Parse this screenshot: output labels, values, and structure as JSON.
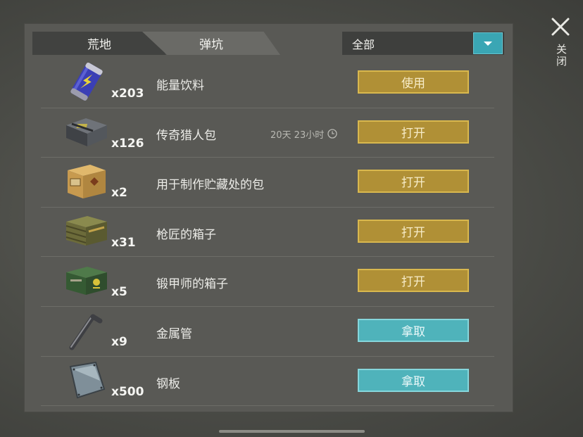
{
  "tabs": [
    {
      "label": "荒地"
    },
    {
      "label": "弹坑"
    }
  ],
  "filter": {
    "label": "全部",
    "dropdown_icon": "chevron-down-icon"
  },
  "close": {
    "label": "关闭",
    "icon": "close-icon"
  },
  "items": [
    {
      "name": "能量饮料",
      "qty": "x203",
      "action": "使用",
      "icon": "energy-drink-can-icon",
      "style": "gold"
    },
    {
      "name": "传奇猎人包",
      "qty": "x126",
      "timer": "20天 23小时",
      "action": "打开",
      "icon": "hunter-bag-icon",
      "style": "gold"
    },
    {
      "name": "用于制作贮藏处的包",
      "qty": "x2",
      "action": "打开",
      "icon": "wooden-crate-icon",
      "style": "gold"
    },
    {
      "name": "枪匠的箱子",
      "qty": "x31",
      "action": "打开",
      "icon": "gunsmith-crate-icon",
      "style": "gold"
    },
    {
      "name": "锻甲师的箱子",
      "qty": "x5",
      "action": "打开",
      "icon": "armorsmith-box-icon",
      "style": "gold"
    },
    {
      "name": "金属管",
      "qty": "x9",
      "action": "拿取",
      "icon": "metal-pipe-icon",
      "style": "cyan"
    },
    {
      "name": "钢板",
      "qty": "x500",
      "action": "拿取",
      "icon": "steel-plate-icon",
      "style": "cyan"
    }
  ],
  "colors": {
    "gold_button": "#b09036",
    "cyan_button": "#4fb3bb",
    "panel": "#595955"
  }
}
